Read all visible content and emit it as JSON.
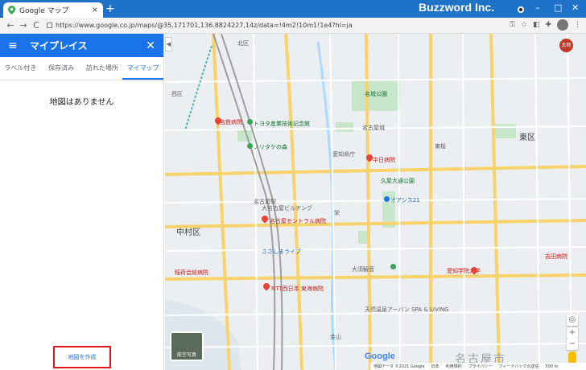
{
  "browser": {
    "tab_title": "Google マップ",
    "new_tab": "+",
    "tab_close": "×",
    "brand": "Buzzword Inc.",
    "url": "https://www.google.co.jp/maps/@35.171701,136.8824227,14z/data=!4m2!10m1!1e4?hl=ja",
    "window_controls": [
      "–",
      "□",
      "✕"
    ],
    "nav": [
      "←",
      "→",
      "C"
    ]
  },
  "panel": {
    "title": "マイプレイス",
    "tabs": [
      "ラベル付き",
      "保存済み",
      "訪れた場所",
      "マイマップ"
    ],
    "active_tab": "マイマップ",
    "empty_message": "地図はありません",
    "create_button": "地図を作成"
  },
  "map": {
    "labels": {
      "city": "名古屋市",
      "castle": "名古屋城",
      "ward_naka": "中村区",
      "ward_higashi": "東区",
      "toyota": "トヨタ産業技術記念館",
      "noritake": "ノリタケの森",
      "nagoya_sta": "名古屋駅",
      "oasis": "オアシス21",
      "osu": "大須観音",
      "nagoya_prefecture": "愛知県庁",
      "dental": "愛知学院大学",
      "hosp1": "名鉄病院",
      "hosp2": "名古屋セントラル病院",
      "hosp3": "中日病院",
      "hosp4": "NTT西日本 東海病院",
      "hosp5": "稲荷会総病院",
      "hosp6": "吉田病院",
      "shrine": "大須観音",
      "park": "名城公園",
      "rider": "ささしまライブ",
      "mall": "久屋大通公園",
      "station2": "栄",
      "dainagoya": "大名古屋ビルヂング",
      "kanayama": "金山",
      "higashi_sakura": "東桜",
      "tenno": "天然温泉アーバン SPA & LIVING",
      "aerial": "航空写真",
      "google": "Google",
      "kita": "北区",
      "nishi": "西区"
    },
    "footer": [
      "地図データ ©2021 Google",
      "日本",
      "利用規約",
      "プライバシー",
      "フィードバックの送信",
      "500 m"
    ],
    "colors": {
      "road_major": "#f9d26b",
      "road": "#ffffff",
      "water": "#aadaff",
      "park": "#c8e6c9",
      "rail": "#9e9e9e"
    }
  },
  "toolbar_icons": [
    "key-icon",
    "star-icon",
    "translate-icon",
    "puzzle-icon",
    "user-icon",
    "menu-icon"
  ],
  "user_initial": "太郎"
}
